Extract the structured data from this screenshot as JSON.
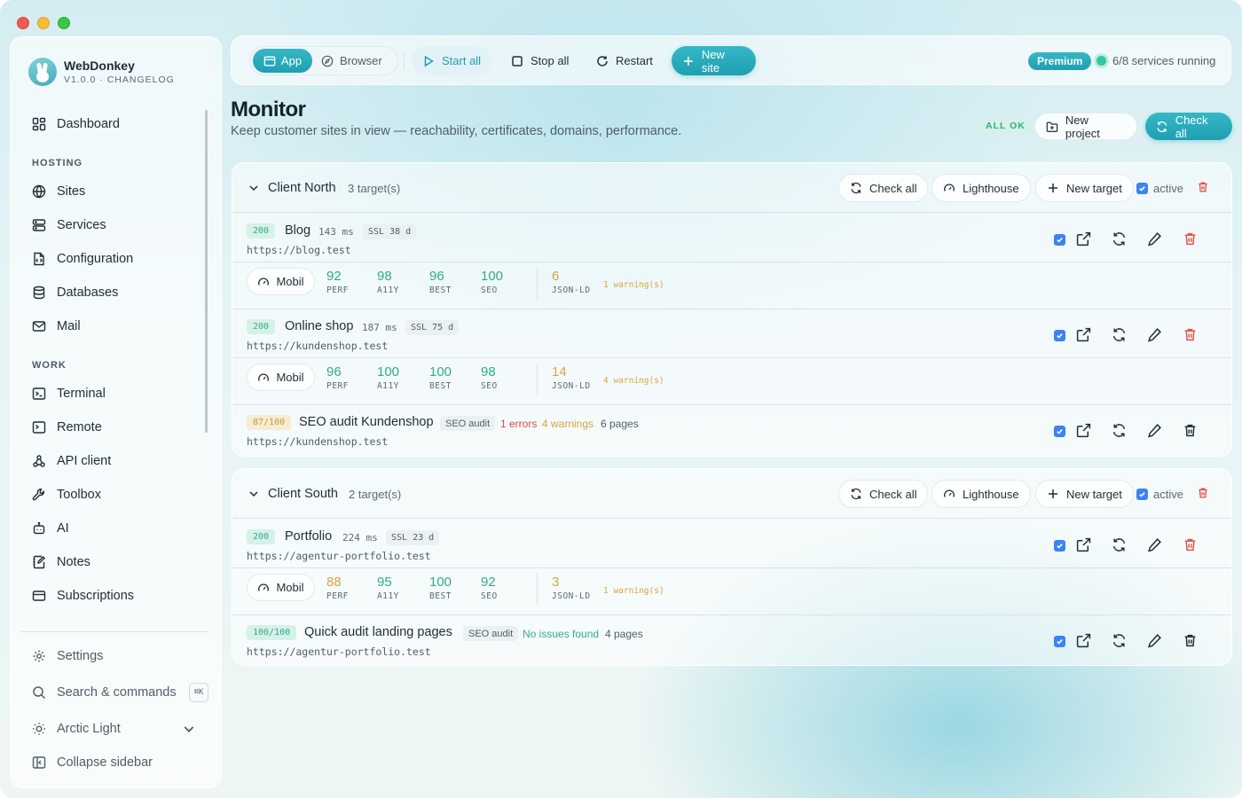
{
  "app": {
    "name": "WebDonkey",
    "version": "V1.0.0 · CHANGELOG"
  },
  "sidebar": {
    "dashboard": "Dashboard",
    "hosting_label": "HOSTING",
    "hosting": [
      "Sites",
      "Services",
      "Configuration",
      "Databases",
      "Mail"
    ],
    "work_label": "WORK",
    "work": [
      "Terminal",
      "Remote",
      "API client",
      "Toolbox",
      "AI",
      "Notes",
      "Subscriptions"
    ],
    "settings": "Settings",
    "search": "Search & commands",
    "search_shortcut": "⌘K",
    "theme": "Arctic Light",
    "collapse": "Collapse sidebar"
  },
  "toolbar": {
    "mode_app": "App",
    "mode_browser": "Browser",
    "start_all": "Start all",
    "stop_all": "Stop all",
    "restart": "Restart",
    "new_site": "New site",
    "premium": "Premium",
    "services_status": "6/8 services running"
  },
  "header": {
    "title": "Monitor",
    "subtitle": "Keep customer sites in view — reachability, certificates, domains, performance.",
    "badge": "ALL OK",
    "new_project": "New project",
    "check_all": "Check all"
  },
  "project_actions": {
    "check_all": "Check all",
    "lighthouse": "Lighthouse",
    "new_target": "New target",
    "active": "active"
  },
  "projects": [
    {
      "name": "Client North",
      "count": "3 target(s)",
      "targets": [
        {
          "status": "200",
          "name": "Blog",
          "ms": "143 ms",
          "ssl": "SSL 38 d",
          "url": "https://blog.test",
          "lighthouse": {
            "device": "Mobil",
            "scores": [
              {
                "value": "92",
                "label": "PERF"
              },
              {
                "value": "98",
                "label": "A11Y"
              },
              {
                "value": "96",
                "label": "BEST"
              },
              {
                "value": "100",
                "label": "SEO"
              }
            ],
            "jsonld": "6",
            "jsonld_label": "JSON-LD",
            "warnings": "1 warning(s)"
          }
        },
        {
          "status": "200",
          "name": "Online shop",
          "ms": "187 ms",
          "ssl": "SSL 75 d",
          "url": "https://kundenshop.test",
          "lighthouse": {
            "device": "Mobil",
            "scores": [
              {
                "value": "96",
                "label": "PERF"
              },
              {
                "value": "100",
                "label": "A11Y"
              },
              {
                "value": "100",
                "label": "BEST"
              },
              {
                "value": "98",
                "label": "SEO"
              }
            ],
            "jsonld": "14",
            "jsonld_label": "JSON-LD",
            "warnings": "4 warning(s)"
          }
        },
        {
          "status": "87/100",
          "name": "SEO audit Kundenshop",
          "tag": "SEO audit",
          "errors": "1 errors",
          "warnings": "4 warnings",
          "pages": "6 pages",
          "url": "https://kundenshop.test"
        }
      ]
    },
    {
      "name": "Client South",
      "count": "2 target(s)",
      "targets": [
        {
          "status": "200",
          "name": "Portfolio",
          "ms": "224 ms",
          "ssl": "SSL 23 d",
          "url": "https://agentur-portfolio.test",
          "lighthouse": {
            "device": "Mobil",
            "scores": [
              {
                "value": "88",
                "label": "PERF"
              },
              {
                "value": "95",
                "label": "A11Y"
              },
              {
                "value": "100",
                "label": "BEST"
              },
              {
                "value": "92",
                "label": "SEO"
              }
            ],
            "jsonld": "3",
            "jsonld_label": "JSON-LD",
            "warnings": "1 warning(s)"
          }
        },
        {
          "status": "100/100",
          "name": "Quick audit landing pages",
          "tag": "SEO audit",
          "ok": "No issues found",
          "pages": "4 pages",
          "url": "https://agentur-portfolio.test"
        }
      ]
    }
  ],
  "colors": {
    "accent": "#1f9fb2",
    "ok": "#2fae88",
    "warning": "#d6a640",
    "error": "#d94a45",
    "checkbox": "#3b82f6"
  }
}
